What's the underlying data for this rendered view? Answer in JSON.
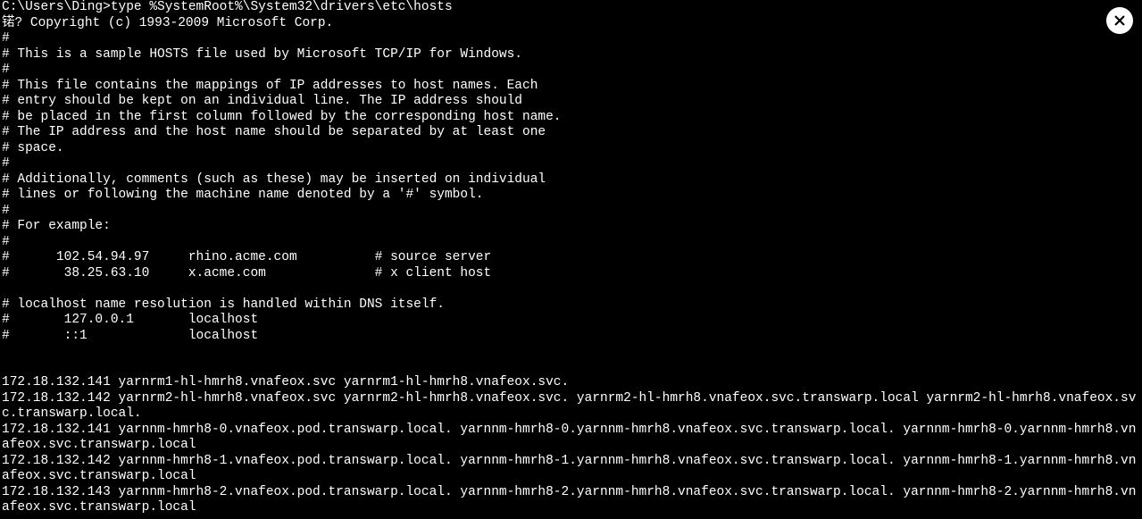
{
  "prompt": "C:\\Users\\Ding>type %SystemRoot%\\System32\\drivers\\etc\\hosts",
  "lines": [
    "锘? Copyright (c) 1993-2009 Microsoft Corp.",
    "#",
    "# This is a sample HOSTS file used by Microsoft TCP/IP for Windows.",
    "#",
    "# This file contains the mappings of IP addresses to host names. Each",
    "# entry should be kept on an individual line. The IP address should",
    "# be placed in the first column followed by the corresponding host name.",
    "# The IP address and the host name should be separated by at least one",
    "# space.",
    "#",
    "# Additionally, comments (such as these) may be inserted on individual",
    "# lines or following the machine name denoted by a '#' symbol.",
    "#",
    "# For example:",
    "#",
    "#      102.54.94.97     rhino.acme.com          # source server",
    "#       38.25.63.10     x.acme.com              # x client host",
    "",
    "# localhost name resolution is handled within DNS itself.",
    "#       127.0.0.1       localhost",
    "#       ::1             localhost",
    "",
    "",
    "172.18.132.141 yarnrm1-hl-hmrh8.vnafeox.svc yarnrm1-hl-hmrh8.vnafeox.svc.",
    "172.18.132.142 yarnrm2-hl-hmrh8.vnafeox.svc yarnrm2-hl-hmrh8.vnafeox.svc. yarnrm2-hl-hmrh8.vnafeox.svc.transwarp.local yarnrm2-hl-hmrh8.vnafeox.svc.transwarp.local.",
    "172.18.132.141 yarnnm-hmrh8-0.vnafeox.pod.transwarp.local. yarnnm-hmrh8-0.yarnnm-hmrh8.vnafeox.svc.transwarp.local. yarnnm-hmrh8-0.yarnnm-hmrh8.vnafeox.svc.transwarp.local",
    "172.18.132.142 yarnnm-hmrh8-1.vnafeox.pod.transwarp.local. yarnnm-hmrh8-1.yarnnm-hmrh8.vnafeox.svc.transwarp.local. yarnnm-hmrh8-1.yarnnm-hmrh8.vnafeox.svc.transwarp.local",
    "172.18.132.143 yarnnm-hmrh8-2.vnafeox.pod.transwarp.local. yarnnm-hmrh8-2.yarnnm-hmrh8.vnafeox.svc.transwarp.local. yarnnm-hmrh8-2.yarnnm-hmrh8.vnafeox.svc.transwarp.local"
  ],
  "close_label": "Close"
}
